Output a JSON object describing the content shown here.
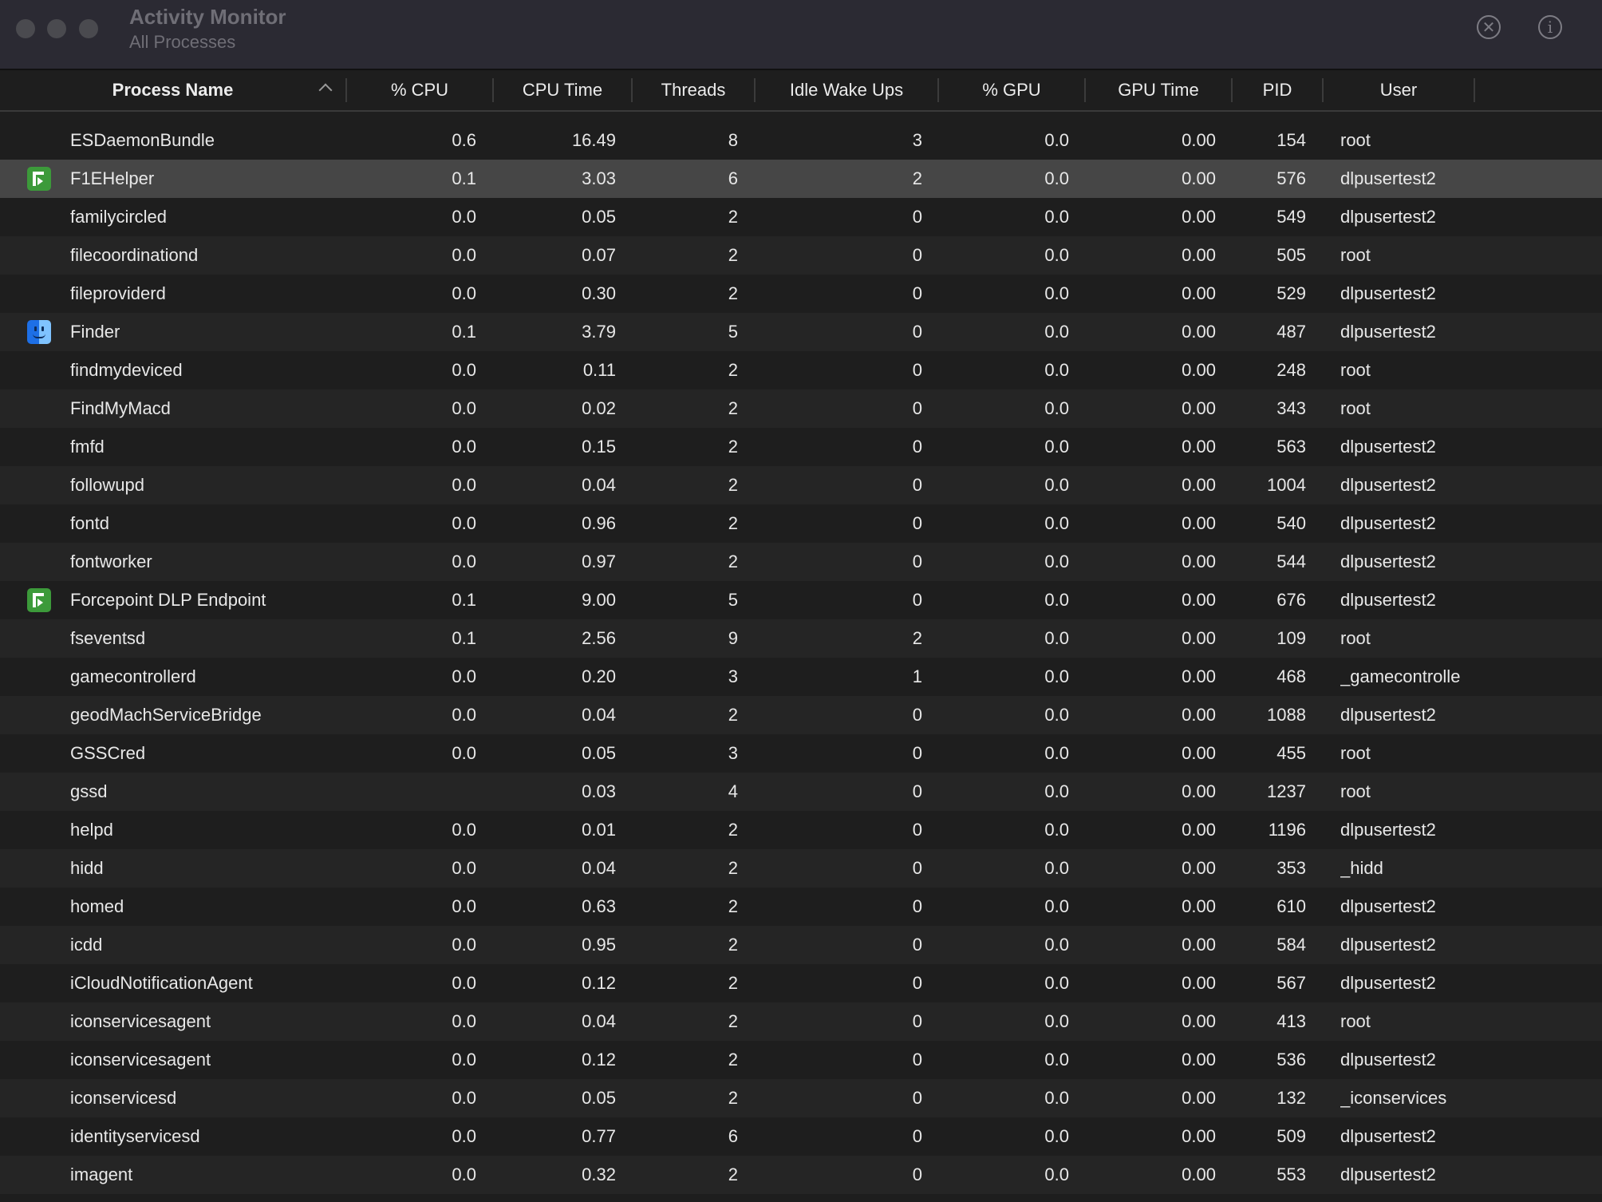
{
  "toolbar": {
    "title": "Activity Monitor",
    "subtitle": "All Processes",
    "stop_icon_glyph": "✕",
    "info_icon_glyph": "i"
  },
  "columns": {
    "name": "Process Name",
    "cpu": "% CPU",
    "cpu_time": "CPU Time",
    "threads": "Threads",
    "idle_wake_ups": "Idle Wake Ups",
    "gpu": "% GPU",
    "gpu_time": "GPU Time",
    "pid": "PID",
    "user": "User"
  },
  "sort": {
    "column": "Process Name",
    "direction": "ascending"
  },
  "selected_row": 1,
  "rows": [
    {
      "icon": "",
      "name": "ESDaemonBundle",
      "cpu": "0.6",
      "cpu_time": "16.49",
      "threads": "8",
      "idle": "3",
      "gpu": "0.0",
      "gpu_time": "0.00",
      "pid": "154",
      "user": "root"
    },
    {
      "icon": "forcepoint-icon",
      "name": "F1EHelper",
      "cpu": "0.1",
      "cpu_time": "3.03",
      "threads": "6",
      "idle": "2",
      "gpu": "0.0",
      "gpu_time": "0.00",
      "pid": "576",
      "user": "dlpusertest2"
    },
    {
      "icon": "",
      "name": "familycircled",
      "cpu": "0.0",
      "cpu_time": "0.05",
      "threads": "2",
      "idle": "0",
      "gpu": "0.0",
      "gpu_time": "0.00",
      "pid": "549",
      "user": "dlpusertest2"
    },
    {
      "icon": "",
      "name": "filecoordinationd",
      "cpu": "0.0",
      "cpu_time": "0.07",
      "threads": "2",
      "idle": "0",
      "gpu": "0.0",
      "gpu_time": "0.00",
      "pid": "505",
      "user": "root"
    },
    {
      "icon": "",
      "name": "fileproviderd",
      "cpu": "0.0",
      "cpu_time": "0.30",
      "threads": "2",
      "idle": "0",
      "gpu": "0.0",
      "gpu_time": "0.00",
      "pid": "529",
      "user": "dlpusertest2"
    },
    {
      "icon": "finder-icon",
      "name": "Finder",
      "cpu": "0.1",
      "cpu_time": "3.79",
      "threads": "5",
      "idle": "0",
      "gpu": "0.0",
      "gpu_time": "0.00",
      "pid": "487",
      "user": "dlpusertest2"
    },
    {
      "icon": "",
      "name": "findmydeviced",
      "cpu": "0.0",
      "cpu_time": "0.11",
      "threads": "2",
      "idle": "0",
      "gpu": "0.0",
      "gpu_time": "0.00",
      "pid": "248",
      "user": "root"
    },
    {
      "icon": "",
      "name": "FindMyMacd",
      "cpu": "0.0",
      "cpu_time": "0.02",
      "threads": "2",
      "idle": "0",
      "gpu": "0.0",
      "gpu_time": "0.00",
      "pid": "343",
      "user": "root"
    },
    {
      "icon": "",
      "name": "fmfd",
      "cpu": "0.0",
      "cpu_time": "0.15",
      "threads": "2",
      "idle": "0",
      "gpu": "0.0",
      "gpu_time": "0.00",
      "pid": "563",
      "user": "dlpusertest2"
    },
    {
      "icon": "",
      "name": "followupd",
      "cpu": "0.0",
      "cpu_time": "0.04",
      "threads": "2",
      "idle": "0",
      "gpu": "0.0",
      "gpu_time": "0.00",
      "pid": "1004",
      "user": "dlpusertest2"
    },
    {
      "icon": "",
      "name": "fontd",
      "cpu": "0.0",
      "cpu_time": "0.96",
      "threads": "2",
      "idle": "0",
      "gpu": "0.0",
      "gpu_time": "0.00",
      "pid": "540",
      "user": "dlpusertest2"
    },
    {
      "icon": "",
      "name": "fontworker",
      "cpu": "0.0",
      "cpu_time": "0.97",
      "threads": "2",
      "idle": "0",
      "gpu": "0.0",
      "gpu_time": "0.00",
      "pid": "544",
      "user": "dlpusertest2"
    },
    {
      "icon": "forcepoint-icon",
      "name": "Forcepoint DLP Endpoint",
      "cpu": "0.1",
      "cpu_time": "9.00",
      "threads": "5",
      "idle": "0",
      "gpu": "0.0",
      "gpu_time": "0.00",
      "pid": "676",
      "user": "dlpusertest2"
    },
    {
      "icon": "",
      "name": "fseventsd",
      "cpu": "0.1",
      "cpu_time": "2.56",
      "threads": "9",
      "idle": "2",
      "gpu": "0.0",
      "gpu_time": "0.00",
      "pid": "109",
      "user": "root"
    },
    {
      "icon": "",
      "name": "gamecontrollerd",
      "cpu": "0.0",
      "cpu_time": "0.20",
      "threads": "3",
      "idle": "1",
      "gpu": "0.0",
      "gpu_time": "0.00",
      "pid": "468",
      "user": "_gamecontrolle"
    },
    {
      "icon": "",
      "name": "geodMachServiceBridge",
      "cpu": "0.0",
      "cpu_time": "0.04",
      "threads": "2",
      "idle": "0",
      "gpu": "0.0",
      "gpu_time": "0.00",
      "pid": "1088",
      "user": "dlpusertest2"
    },
    {
      "icon": "",
      "name": "GSSCred",
      "cpu": "0.0",
      "cpu_time": "0.05",
      "threads": "3",
      "idle": "0",
      "gpu": "0.0",
      "gpu_time": "0.00",
      "pid": "455",
      "user": "root"
    },
    {
      "icon": "",
      "name": "gssd",
      "cpu": "",
      "cpu_time": "0.03",
      "threads": "4",
      "idle": "0",
      "gpu": "0.0",
      "gpu_time": "0.00",
      "pid": "1237",
      "user": "root"
    },
    {
      "icon": "",
      "name": "helpd",
      "cpu": "0.0",
      "cpu_time": "0.01",
      "threads": "2",
      "idle": "0",
      "gpu": "0.0",
      "gpu_time": "0.00",
      "pid": "1196",
      "user": "dlpusertest2"
    },
    {
      "icon": "",
      "name": "hidd",
      "cpu": "0.0",
      "cpu_time": "0.04",
      "threads": "2",
      "idle": "0",
      "gpu": "0.0",
      "gpu_time": "0.00",
      "pid": "353",
      "user": "_hidd"
    },
    {
      "icon": "",
      "name": "homed",
      "cpu": "0.0",
      "cpu_time": "0.63",
      "threads": "2",
      "idle": "0",
      "gpu": "0.0",
      "gpu_time": "0.00",
      "pid": "610",
      "user": "dlpusertest2"
    },
    {
      "icon": "",
      "name": "icdd",
      "cpu": "0.0",
      "cpu_time": "0.95",
      "threads": "2",
      "idle": "0",
      "gpu": "0.0",
      "gpu_time": "0.00",
      "pid": "584",
      "user": "dlpusertest2"
    },
    {
      "icon": "",
      "name": "iCloudNotificationAgent",
      "cpu": "0.0",
      "cpu_time": "0.12",
      "threads": "2",
      "idle": "0",
      "gpu": "0.0",
      "gpu_time": "0.00",
      "pid": "567",
      "user": "dlpusertest2"
    },
    {
      "icon": "",
      "name": "iconservicesagent",
      "cpu": "0.0",
      "cpu_time": "0.04",
      "threads": "2",
      "idle": "0",
      "gpu": "0.0",
      "gpu_time": "0.00",
      "pid": "413",
      "user": "root"
    },
    {
      "icon": "",
      "name": "iconservicesagent",
      "cpu": "0.0",
      "cpu_time": "0.12",
      "threads": "2",
      "idle": "0",
      "gpu": "0.0",
      "gpu_time": "0.00",
      "pid": "536",
      "user": "dlpusertest2"
    },
    {
      "icon": "",
      "name": "iconservicesd",
      "cpu": "0.0",
      "cpu_time": "0.05",
      "threads": "2",
      "idle": "0",
      "gpu": "0.0",
      "gpu_time": "0.00",
      "pid": "132",
      "user": "_iconservices"
    },
    {
      "icon": "",
      "name": "identityservicesd",
      "cpu": "0.0",
      "cpu_time": "0.77",
      "threads": "6",
      "idle": "0",
      "gpu": "0.0",
      "gpu_time": "0.00",
      "pid": "509",
      "user": "dlpusertest2"
    },
    {
      "icon": "",
      "name": "imagent",
      "cpu": "0.0",
      "cpu_time": "0.32",
      "threads": "2",
      "idle": "0",
      "gpu": "0.0",
      "gpu_time": "0.00",
      "pid": "553",
      "user": "dlpusertest2"
    }
  ]
}
